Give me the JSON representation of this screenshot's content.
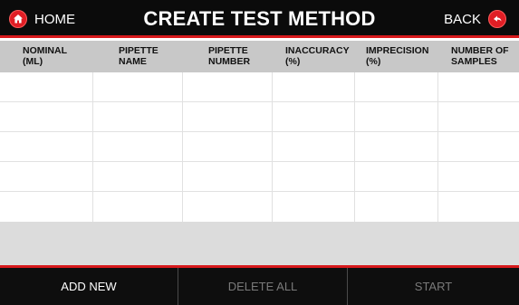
{
  "header": {
    "home_label": "HOME",
    "title": "CREATE TEST METHOD",
    "back_label": "BACK",
    "home_icon": "home-icon",
    "back_icon": "back-arrow-icon",
    "accent": "#d7191c"
  },
  "table": {
    "columns": [
      {
        "line1": "NOMINAL",
        "line2": "(ml)"
      },
      {
        "line1": "PIPETTE",
        "line2": "NAME"
      },
      {
        "line1": "PIPETTE",
        "line2": "NUMBER"
      },
      {
        "line1": "INACCURACY",
        "line2": "(%)"
      },
      {
        "line1": "IMPRECISION",
        "line2": "(%)"
      },
      {
        "line1": "NUMBER OF",
        "line2": "SAMPLES"
      }
    ],
    "rows": [
      [
        "",
        "",
        "",
        "",
        "",
        ""
      ],
      [
        "",
        "",
        "",
        "",
        "",
        ""
      ],
      [
        "",
        "",
        "",
        "",
        "",
        ""
      ],
      [
        "",
        "",
        "",
        "",
        "",
        ""
      ],
      [
        "",
        "",
        "",
        "",
        "",
        ""
      ]
    ]
  },
  "footer": {
    "add_new_label": "ADD NEW",
    "delete_all_label": "DELETE ALL",
    "start_label": "START"
  }
}
